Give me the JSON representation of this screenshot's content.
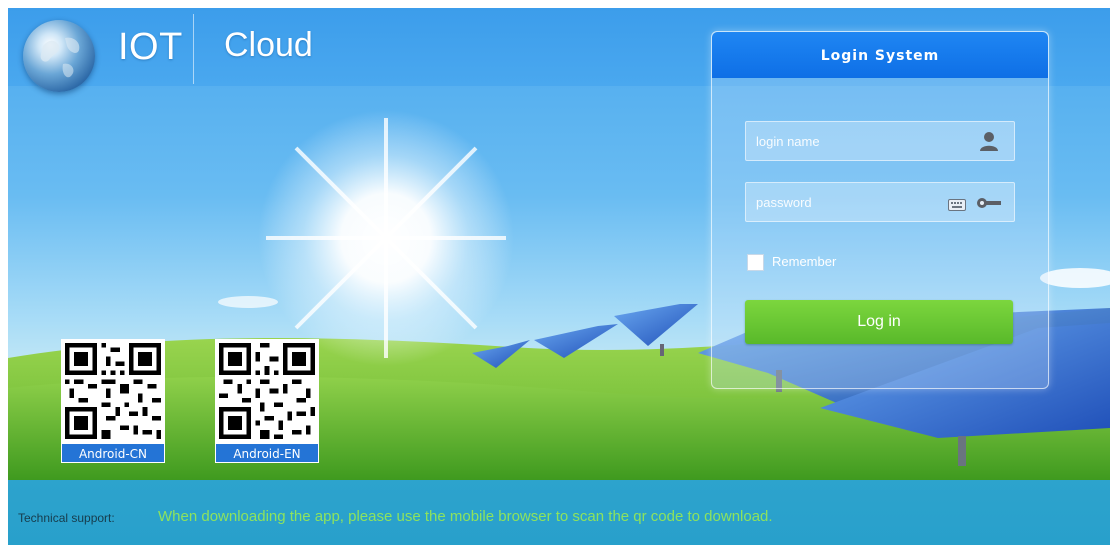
{
  "header": {
    "brand_left": "IOT",
    "brand_right": "Cloud",
    "logo_icon": "globe-icon"
  },
  "qr_codes": [
    {
      "label": "Android-CN",
      "icon": "qr-code-icon"
    },
    {
      "label": "Android-EN",
      "icon": "qr-code-icon"
    }
  ],
  "login": {
    "title": "Login System",
    "username_placeholder": "login name",
    "username_icon": "user-icon",
    "password_placeholder": "password",
    "keyboard_icon": "keyboard-icon",
    "key_icon": "key-icon",
    "remember_label": "Remember",
    "remember_checked": false,
    "submit_label": "Log in"
  },
  "footer": {
    "label": "Technical support:",
    "message": "When downloading the app, please use the mobile browser to scan the qr code to download."
  },
  "colors": {
    "header_blue": "#3c9deb",
    "login_header": "#0e6fe6",
    "login_button": "#59b92a",
    "footer_bg": "#2da3cd",
    "footer_text": "#8de35e"
  }
}
